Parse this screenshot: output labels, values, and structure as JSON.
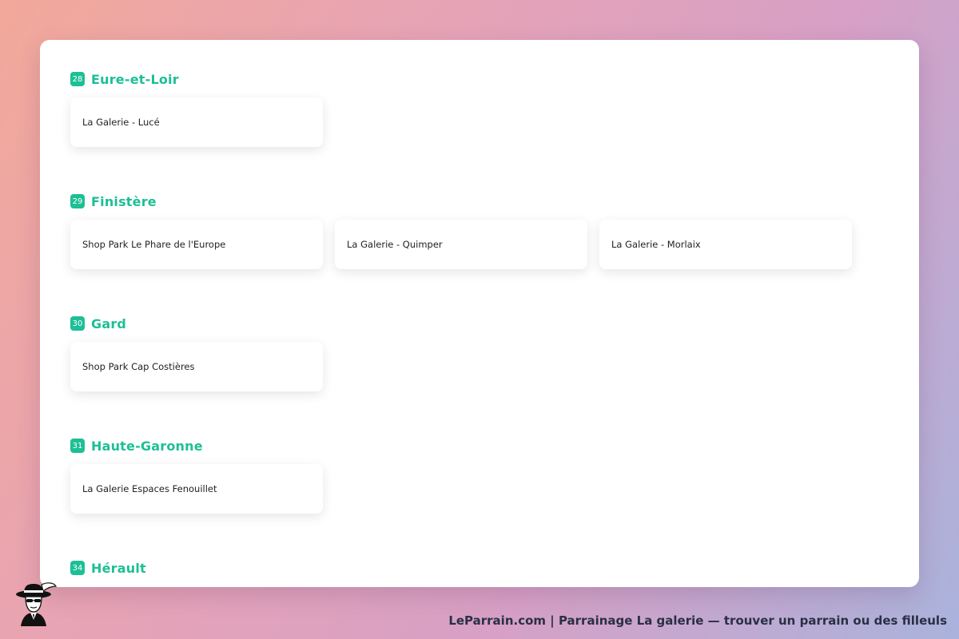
{
  "sections": [
    {
      "number": "28",
      "title": "Eure-et-Loir",
      "items": [
        "La Galerie - Lucé"
      ]
    },
    {
      "number": "29",
      "title": "Finistère",
      "items": [
        "Shop Park Le Phare de l'Europe",
        "La Galerie - Quimper",
        "La Galerie - Morlaix"
      ]
    },
    {
      "number": "30",
      "title": "Gard",
      "items": [
        "Shop Park Cap Costières"
      ]
    },
    {
      "number": "31",
      "title": "Haute-Garonne",
      "items": [
        "La Galerie Espaces Fenouillet"
      ]
    },
    {
      "number": "34",
      "title": "Hérault",
      "items": []
    }
  ],
  "footer": {
    "caption": "LeParrain.com | Parrainage La galerie — trouver un parrain ou des filleuls",
    "logo_icon": "mascot-logo-icon"
  },
  "colors": {
    "accent": "#1dbf95",
    "footer_text": "#2b2f45"
  }
}
